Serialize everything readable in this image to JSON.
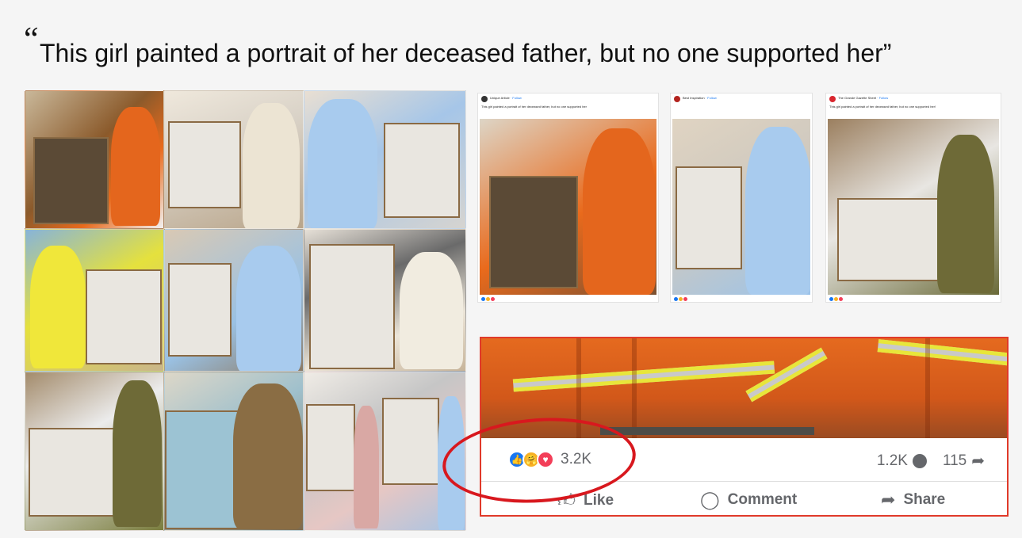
{
  "headline": {
    "quote_mark": "“",
    "text": "This girl painted a portrait of her deceased father, but no one supported her”"
  },
  "posts": [
    {
      "author": "Unique Article",
      "follow": "· Follow",
      "caption": "This girl painted a portrait of her deceased father, but no one supported her"
    },
    {
      "author": "Best Inspiration",
      "follow": "· Follow",
      "caption": ""
    },
    {
      "author": "The Grande Gazette Sheet",
      "follow": "· Follow",
      "caption": "This girl painted a portrait of her deceased father, but no one supported her!"
    }
  ],
  "post_card": {
    "reaction_count": "3.2K",
    "comment_count": "1.2K",
    "share_count": "115",
    "like_label": "Like",
    "comment_label": "Comment",
    "share_label": "Share"
  },
  "colors": {
    "annotation_circle": "#d8181e",
    "card_border": "#e03a2a",
    "like_blue": "#1877f2",
    "love_red": "#f33e58",
    "care_yellow": "#f7b125"
  },
  "icons": [
    "like-reaction-icon",
    "care-reaction-icon",
    "love-reaction-icon",
    "comment-bubble-icon",
    "share-arrow-icon",
    "thumbs-up-icon",
    "comment-icon",
    "share-icon"
  ]
}
